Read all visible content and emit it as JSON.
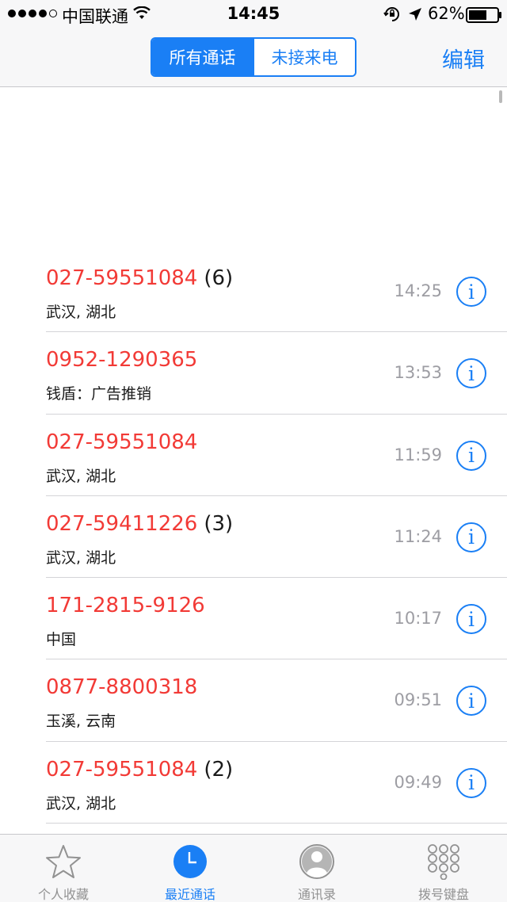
{
  "status_bar": {
    "carrier": "中国联通",
    "time": "14:45",
    "battery": "62%"
  },
  "nav": {
    "segments": [
      "所有通话",
      "未接来电"
    ],
    "selected_segment": "所有通话",
    "edit_label": "编辑"
  },
  "calls": [
    {
      "number": "027-59551084",
      "count": "(6)",
      "location": "武汉, 湖北",
      "time": "14:25"
    },
    {
      "number": "0952-1290365",
      "count": "",
      "location": "钱盾：广告推销",
      "time": "13:53"
    },
    {
      "number": "027-59551084",
      "count": "",
      "location": "武汉, 湖北",
      "time": "11:59"
    },
    {
      "number": "027-59411226",
      "count": "(3)",
      "location": "武汉, 湖北",
      "time": "11:24"
    },
    {
      "number": "171-2815-9126",
      "count": "",
      "location": "中国",
      "time": "10:17"
    },
    {
      "number": "0877-8800318",
      "count": "",
      "location": "玉溪, 云南",
      "time": "09:51"
    },
    {
      "number": "027-59551084",
      "count": "(2)",
      "location": "武汉, 湖北",
      "time": "09:49"
    }
  ],
  "tabs": [
    {
      "label": "个人收藏",
      "icon": "star-icon"
    },
    {
      "label": "最近通话",
      "icon": "clock-icon"
    },
    {
      "label": "通讯录",
      "icon": "contact-icon"
    },
    {
      "label": "拨号键盘",
      "icon": "keypad-icon"
    }
  ],
  "active_tab": "最近通话",
  "colors": {
    "accent": "#1a7ff5",
    "missed_call": "#f23a36",
    "secondary_text": "#9d9da3"
  }
}
